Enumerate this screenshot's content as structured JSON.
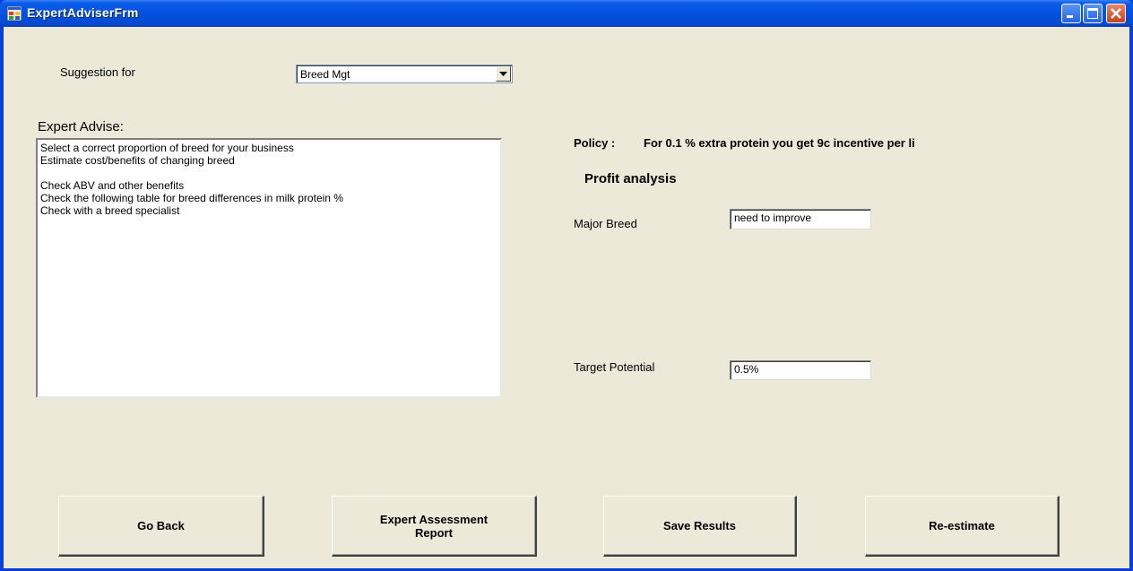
{
  "window": {
    "title": "ExpertAdviserFrm",
    "controls": [
      "minimize-icon",
      "maximize-icon",
      "close-icon"
    ]
  },
  "suggestion": {
    "label": "Suggestion for",
    "selected": "Breed Mgt"
  },
  "advice": {
    "heading": "Expert Advise:",
    "lines": [
      "Select a correct proportion of breed for your business",
      "Estimate cost/benefits of changing breed",
      "",
      "Check ABV and other benefits",
      "Check the following table for breed differences in milk protein %",
      "Check with a breed specialist"
    ]
  },
  "policy": {
    "label": "Policy :",
    "text": "For 0.1 % extra protein you get 9c incentive per li"
  },
  "profit": {
    "heading": "Profit analysis",
    "major_breed_label": "Major Breed",
    "major_breed_value": "need to improve",
    "target_label": "Target Potential",
    "target_value": "0.5%"
  },
  "buttons": {
    "go_back": "Go Back",
    "report_line1": "Expert Assessment",
    "report_line2": "Report",
    "save": "Save Results",
    "reestimate": "Re-estimate"
  },
  "colors": {
    "titlebar": "#0552e0",
    "form_bg": "#ece9d8",
    "close_button": "#c8421c"
  }
}
